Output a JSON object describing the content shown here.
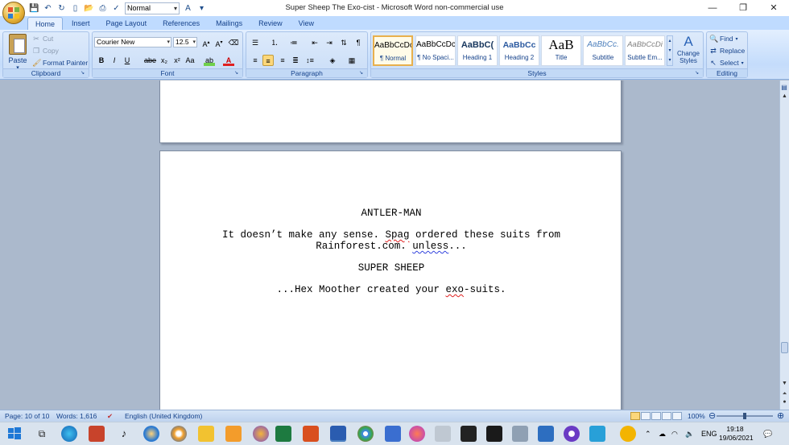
{
  "window": {
    "title": "Super Sheep The Exo-cist - Microsoft Word non-commercial use",
    "controls": {
      "minimize": "—",
      "maximize": "❐",
      "close": "✕"
    }
  },
  "qat": {
    "style_value": "Normal"
  },
  "tabs": [
    "Home",
    "Insert",
    "Page Layout",
    "References",
    "Mailings",
    "Review",
    "View"
  ],
  "ribbon": {
    "clipboard": {
      "paste": "Paste",
      "cut": "Cut",
      "copy": "Copy",
      "format_painter": "Format Painter",
      "label": "Clipboard"
    },
    "font": {
      "family": "Courier New",
      "size": "12.5",
      "label": "Font"
    },
    "paragraph": {
      "label": "Paragraph"
    },
    "styles": {
      "label": "Styles",
      "items": [
        {
          "sample": "AaBbCcDc",
          "name": "¶ Normal"
        },
        {
          "sample": "AaBbCcDc",
          "name": "¶ No Spaci..."
        },
        {
          "sample": "AaBbC(",
          "name": "Heading 1"
        },
        {
          "sample": "AaBbCc",
          "name": "Heading 2"
        },
        {
          "sample": "AaB",
          "name": "Title"
        },
        {
          "sample": "AaBbCc.",
          "name": "Subtitle"
        },
        {
          "sample": "AaBbCcDi",
          "name": "Subtle Em..."
        }
      ],
      "change_styles": "Change Styles"
    },
    "editing": {
      "find": "Find",
      "replace": "Replace",
      "select": "Select",
      "label": "Editing"
    }
  },
  "document": {
    "character1": "ANTLER-MAN",
    "dialogue1_line1_a": "It doesn’t make any sense. ",
    "dialogue1_line1_b": "Spag",
    "dialogue1_line1_c": " ordered these suits from",
    "dialogue1_line2_a": "Rainforest.com. ",
    "dialogue1_line2_b": "unless",
    "dialogue1_line2_c": "...",
    "character2": "SUPER SHEEP",
    "dialogue2_a": "...Hex Moother created your ",
    "dialogue2_b": "exo",
    "dialogue2_c": "-suits."
  },
  "status": {
    "page": "Page: 10 of 10",
    "words": "Words: 1,616",
    "language": "English (United Kingdom)",
    "zoom": "100%"
  },
  "taskbar": {
    "lang": "ENG",
    "time": "19:18",
    "date": "19/06/2021"
  },
  "colors": {
    "ribbon": "#c4dcfb",
    "accent": "#15428b",
    "selected": "#fcd77a"
  }
}
